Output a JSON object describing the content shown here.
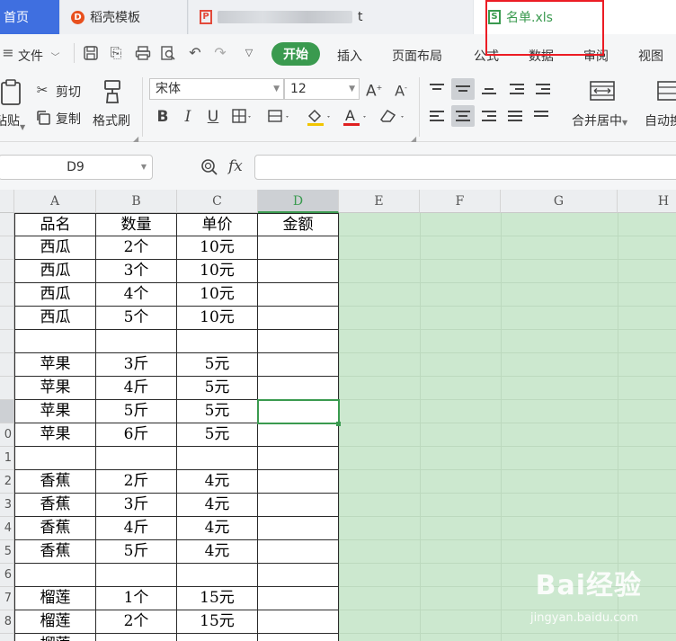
{
  "tabs": {
    "home": "首页",
    "daoke": "稻壳模板",
    "blurred_suffix": "t",
    "active_file": "名单.xls"
  },
  "menu": {
    "file": "文件",
    "items": [
      "开始",
      "插入",
      "页面布局",
      "公式",
      "数据",
      "审阅",
      "视图"
    ]
  },
  "ribbon": {
    "paste": "粘贴",
    "cut": "剪切",
    "copy": "复制",
    "format_painter": "格式刷",
    "font_name": "宋体",
    "font_size": "12",
    "merge_center": "合并居中",
    "auto_wrap": "自动换"
  },
  "formula_bar": {
    "name_box": "D9",
    "fx_label": "fx",
    "formula": ""
  },
  "sheet": {
    "columns": [
      "A",
      "B",
      "C",
      "D",
      "E",
      "F",
      "G",
      "H"
    ],
    "row_numbers": [
      "",
      "",
      "",
      "",
      "",
      "",
      "",
      "",
      "",
      "0",
      "1",
      "2",
      "3",
      "4",
      "5",
      "6",
      "7",
      "8",
      ""
    ],
    "rows": [
      [
        "品名",
        "数量",
        "单价",
        "金额"
      ],
      [
        "西瓜",
        "2个",
        "10元",
        ""
      ],
      [
        "西瓜",
        "3个",
        "10元",
        ""
      ],
      [
        "西瓜",
        "4个",
        "10元",
        ""
      ],
      [
        "西瓜",
        "5个",
        "10元",
        ""
      ],
      [
        "",
        "",
        "",
        ""
      ],
      [
        "苹果",
        "3斤",
        "5元",
        ""
      ],
      [
        "苹果",
        "4斤",
        "5元",
        ""
      ],
      [
        "苹果",
        "5斤",
        "5元",
        ""
      ],
      [
        "苹果",
        "6斤",
        "5元",
        ""
      ],
      [
        "",
        "",
        "",
        ""
      ],
      [
        "香蕉",
        "2斤",
        "4元",
        ""
      ],
      [
        "香蕉",
        "3斤",
        "4元",
        ""
      ],
      [
        "香蕉",
        "4斤",
        "4元",
        ""
      ],
      [
        "香蕉",
        "5斤",
        "4元",
        ""
      ],
      [
        "",
        "",
        "",
        ""
      ],
      [
        "榴莲",
        "1个",
        "15元",
        ""
      ],
      [
        "榴莲",
        "2个",
        "15元",
        ""
      ],
      [
        "榴莲",
        "",
        "",
        ""
      ]
    ]
  },
  "watermark": {
    "brand": "Bai经验",
    "url": "jingyan.baidu.com"
  },
  "colors": {
    "accent": "#3a9a4f",
    "highlight_box": "#ec1c24",
    "tab_home": "#3f6fe0",
    "sheet_green": "#cce8cf"
  }
}
